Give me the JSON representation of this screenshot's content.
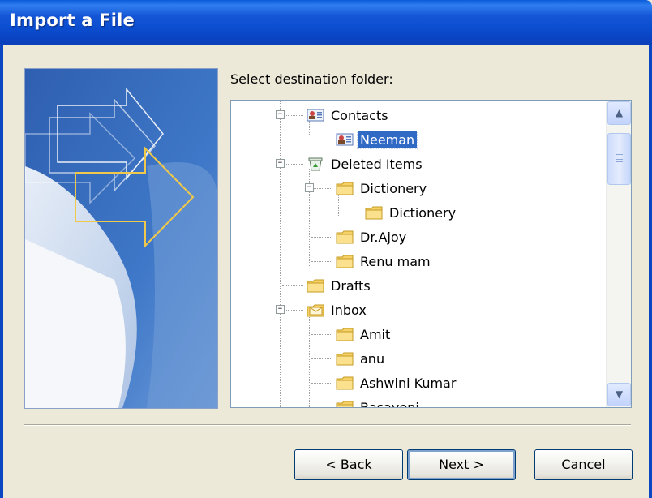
{
  "window": {
    "title": "Import a File"
  },
  "prompt": "Select destination folder:",
  "tree": {
    "items": [
      {
        "label": "Contacts",
        "icon": "contacts-icon",
        "expanded": true
      },
      {
        "label": "Neeman",
        "icon": "contacts-icon",
        "selected": true
      },
      {
        "label": "Deleted Items",
        "icon": "deleted-items-icon",
        "expanded": true
      },
      {
        "label": "Dictionery",
        "icon": "folder-icon",
        "expanded": true
      },
      {
        "label": "Dictionery",
        "icon": "folder-icon"
      },
      {
        "label": "Dr.Ajoy",
        "icon": "folder-icon"
      },
      {
        "label": "Renu mam",
        "icon": "folder-icon"
      },
      {
        "label": "Drafts",
        "icon": "folder-icon"
      },
      {
        "label": "Inbox",
        "icon": "inbox-icon",
        "expanded": true
      },
      {
        "label": "Amit",
        "icon": "folder-icon"
      },
      {
        "label": "anu",
        "icon": "folder-icon"
      },
      {
        "label": "Ashwini Kumar",
        "icon": "folder-icon"
      },
      {
        "label": "Basaveni",
        "icon": "folder-icon"
      }
    ]
  },
  "buttons": {
    "back": "< Back",
    "next": "Next >",
    "cancel": "Cancel"
  },
  "colors": {
    "titlebar": "#0b4ed0",
    "selection": "#316ac5",
    "folder": "#f6d168"
  }
}
